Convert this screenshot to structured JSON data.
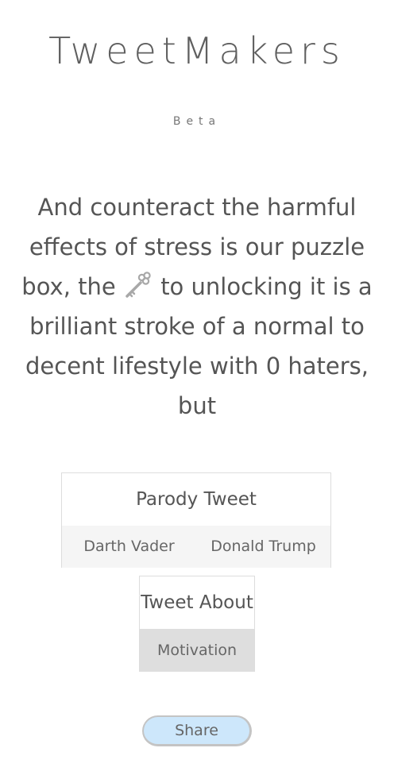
{
  "header": {
    "title": "TweetMakers",
    "badge": "Beta"
  },
  "tweet": {
    "text_before_icon": "And counteract the harmful effects of stress is our puzzle box, the",
    "icon": "key-icon",
    "text_after_icon": "to unlocking it is a brilliant stroke of a normal to decent lifestyle with 0 haters, but"
  },
  "parody": {
    "title": "Parody Tweet",
    "options": [
      "Darth Vader",
      "Donald Trump"
    ]
  },
  "about": {
    "title": "Tweet About",
    "selected": "Motivation"
  },
  "share": {
    "label": "Share"
  },
  "colors": {
    "text": "#555555",
    "option_bar": "#f5f5f5",
    "selected_option": "#dedede",
    "share_button": "#cde7fb"
  }
}
